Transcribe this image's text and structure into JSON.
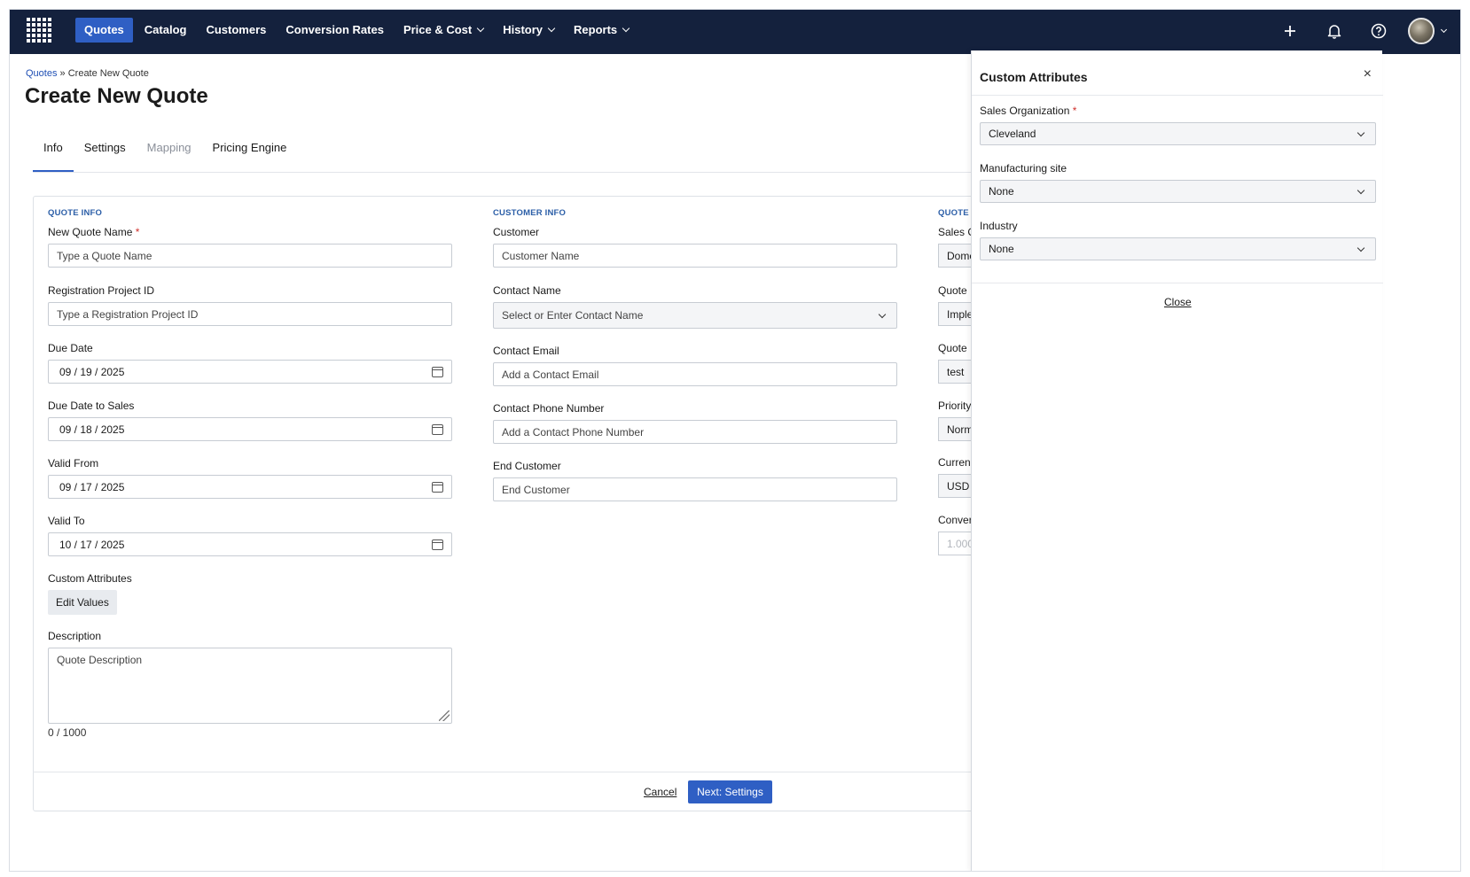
{
  "nav": {
    "items": [
      {
        "label": "Quotes",
        "active": true,
        "dropdown": false
      },
      {
        "label": "Catalog",
        "active": false,
        "dropdown": false
      },
      {
        "label": "Customers",
        "active": false,
        "dropdown": false
      },
      {
        "label": "Conversion Rates",
        "active": false,
        "dropdown": false
      },
      {
        "label": "Price & Cost",
        "active": false,
        "dropdown": true
      },
      {
        "label": "History",
        "active": false,
        "dropdown": true
      },
      {
        "label": "Reports",
        "active": false,
        "dropdown": true
      }
    ],
    "right_icons": [
      "plus-icon",
      "bell-icon",
      "help-icon"
    ]
  },
  "breadcrumb": {
    "root": "Quotes",
    "separator": "»",
    "current": "Create New Quote"
  },
  "page_title": "Create New Quote",
  "tabs": [
    {
      "label": "Info",
      "state": "active"
    },
    {
      "label": "Settings",
      "state": "normal"
    },
    {
      "label": "Mapping",
      "state": "disabled"
    },
    {
      "label": "Pricing Engine",
      "state": "normal"
    }
  ],
  "quote_info": {
    "section": "QUOTE INFO",
    "name_label": "New Quote Name",
    "name_placeholder": "Type a Quote Name",
    "reg_label": "Registration Project ID",
    "reg_placeholder": "Type a Registration Project ID",
    "due_label": "Due Date",
    "due_value": "09 / 19 / 2025",
    "due_sales_label": "Due Date to Sales",
    "due_sales_value": "09 / 18 / 2025",
    "valid_from_label": "Valid From",
    "valid_from_value": "09 / 17 / 2025",
    "valid_to_label": "Valid To",
    "valid_to_value": "10 / 17 / 2025",
    "custom_attr_label": "Custom Attributes",
    "edit_values": "Edit Values",
    "desc_label": "Description",
    "desc_placeholder": "Quote Description",
    "counter": "0 / 1000"
  },
  "customer_info": {
    "section": "CUSTOMER INFO",
    "customer_label": "Customer",
    "customer_placeholder": "Customer Name",
    "contact_label": "Contact Name",
    "contact_placeholder": "Select or Enter Contact Name",
    "email_label": "Contact Email",
    "email_placeholder": "Add a Contact Email",
    "phone_label": "Contact Phone Number",
    "phone_placeholder": "Add a Contact Phone Number",
    "end_label": "End Customer",
    "end_placeholder": "End Customer"
  },
  "third_col": {
    "section": "QUOTE",
    "labels": [
      "Sales C",
      "Quote",
      "Quote",
      "Priority",
      "Curren",
      "Conver"
    ],
    "values": [
      "Dome",
      "Imple",
      "test",
      "Norm",
      "USD",
      "1.000"
    ]
  },
  "footer": {
    "cancel": "Cancel",
    "next": "Next: Settings"
  },
  "panel": {
    "title": "Custom Attributes",
    "close_x": "×",
    "sales_org_label": "Sales Organization",
    "sales_org_value": "Cleveland",
    "mfg_label": "Manufacturing site",
    "mfg_value": "None",
    "industry_label": "Industry",
    "industry_value": "None",
    "close_link": "Close"
  },
  "colors": {
    "nav_bg": "#14213d",
    "accent": "#2f5fc4",
    "required": "#d0312d"
  }
}
